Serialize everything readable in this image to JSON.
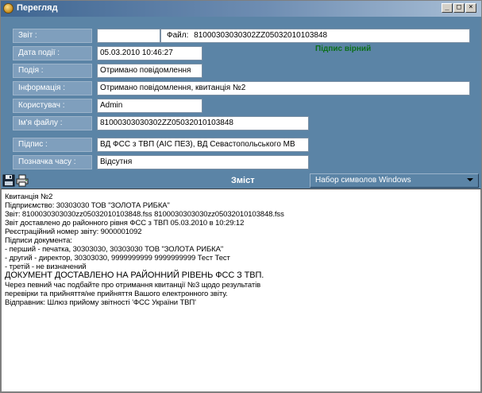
{
  "window": {
    "title": "Перегляд",
    "buttons": {
      "minimize": "_",
      "maximize": "□",
      "close": "×"
    }
  },
  "form": {
    "report": {
      "label": "Звіт :",
      "value": "",
      "file_label": "Файл:",
      "file_value": "81000303030302ZZ05032010103848"
    },
    "event_date": {
      "label": "Дата події :",
      "value": "05.03.2010 10:46:27"
    },
    "event": {
      "label": "Подія :",
      "value": "Отримано повідомлення"
    },
    "info": {
      "label": "Інформація :",
      "value": "Отримано повідомлення, квитанція №2"
    },
    "user": {
      "label": "Користувач :",
      "value": "Admin"
    },
    "file_name": {
      "label": "Ім'я файлу :",
      "value": "81000303030302ZZ05032010103848"
    },
    "signature": {
      "label": "Підпис :",
      "value": "ВД ФСС з ТВП (АІС ПЕЗ), ВД Севастопольського МВ",
      "status": "Підпис вірний"
    },
    "timestamp": {
      "label": "Позначка часу :",
      "value": "Відсутня"
    }
  },
  "toolbar": {
    "save_icon": "save-icon",
    "print_icon": "print-icon",
    "contents_title": "Зміст",
    "charset_value": "Набор символов Windows"
  },
  "content": {
    "lines": [
      "Квитанція №2",
      "Підприємство: 30303030 ТОВ \"ЗОЛОТА РИБКА\"",
      "Звіт: 8100030303030zz05032010103848.fss      8100030303030zz05032010103848.fss",
      "Звіт доставлено до районного рівня ФСС з ТВП 05.03.2010 в 10:29:12",
      "Реєстраційний номер звіту: 9000001092",
      "Підписи документа:",
      "- перший - печатка, 30303030, 30303030 ТОВ \"ЗОЛОТА РИБКА\"",
      "- другий - директор, 30303030, 9999999999 9999999999 Тест Тест",
      "- третій - не визначений",
      "ДОКУМЕНТ ДОСТАВЛЕНО НА РАЙОННИЙ РІВЕНЬ ФСС З ТВП.",
      "Через певний час подбайте про отримання квитанції №3 щодо результатів",
      "перевірки та прийняття/не прийняття Вашого електронного звіту.",
      "Відправник: Шлюз прийому звітності 'ФСС України ТВП'"
    ]
  }
}
